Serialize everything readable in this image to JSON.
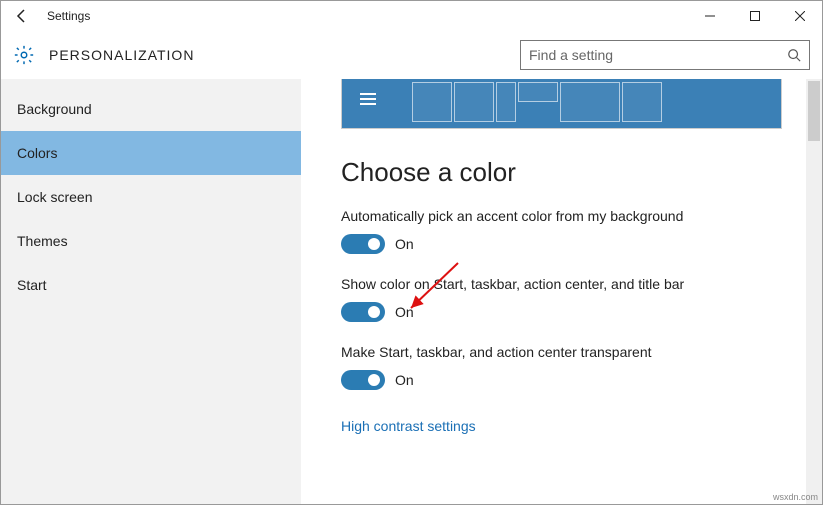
{
  "window": {
    "title": "Settings"
  },
  "header": {
    "title": "PERSONALIZATION"
  },
  "search": {
    "placeholder": "Find a setting"
  },
  "sidebar": {
    "items": [
      {
        "label": "Background",
        "selected": false
      },
      {
        "label": "Colors",
        "selected": true
      },
      {
        "label": "Lock screen",
        "selected": false
      },
      {
        "label": "Themes",
        "selected": false
      },
      {
        "label": "Start",
        "selected": false
      }
    ]
  },
  "content": {
    "section_title": "Choose a color",
    "settings": [
      {
        "label": "Automatically pick an accent color from my background",
        "state": "On",
        "on": true
      },
      {
        "label": "Show color on Start, taskbar, action center, and title bar",
        "state": "On",
        "on": true
      },
      {
        "label": "Make Start, taskbar, and action center transparent",
        "state": "On",
        "on": true
      }
    ],
    "link": "High contrast settings"
  },
  "colors": {
    "accent": "#2b7cb3",
    "preview": "#3b80b6",
    "selected_nav": "#82b8e2"
  },
  "watermark": "wsxdn.com"
}
